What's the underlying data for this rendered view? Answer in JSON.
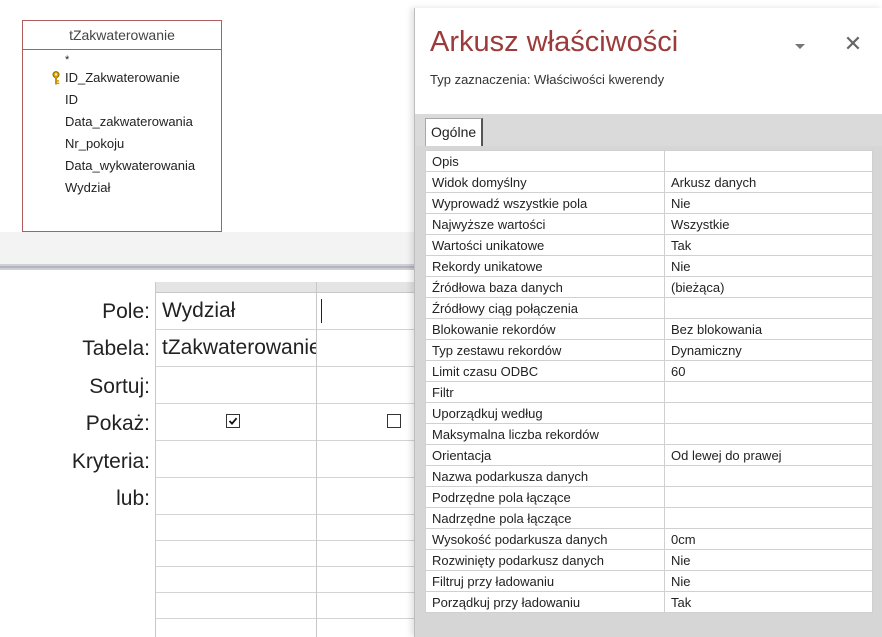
{
  "table": {
    "title": "tZakwaterowanie",
    "fields": [
      {
        "name": "*",
        "key": false
      },
      {
        "name": "ID_Zakwaterowanie",
        "key": true
      },
      {
        "name": "ID",
        "key": false
      },
      {
        "name": "Data_zakwaterowania",
        "key": false
      },
      {
        "name": "Nr_pokoju",
        "key": false
      },
      {
        "name": "Data_wykwaterowania",
        "key": false
      },
      {
        "name": "Wydział",
        "key": false
      }
    ]
  },
  "grid": {
    "row_labels": {
      "field": "Pole:",
      "table": "Tabela:",
      "sort": "Sortuj:",
      "show": "Pokaż:",
      "criteria": "Kryteria:",
      "or": "lub:"
    },
    "columns": [
      {
        "field": "Wydział",
        "table": "tZakwaterowanie",
        "sort": "",
        "show": true,
        "criteria": "",
        "or": ""
      },
      {
        "field": "",
        "table": "",
        "sort": "",
        "show": false,
        "criteria": "",
        "or": ""
      }
    ]
  },
  "property_sheet": {
    "title": "Arkusz właściwości",
    "selection_type": "Typ zaznaczenia:  Właściwości kwerendy",
    "close_glyph": "✕",
    "tab": "Ogólne",
    "properties": [
      {
        "name": "Opis",
        "value": ""
      },
      {
        "name": "Widok domyślny",
        "value": "Arkusz danych"
      },
      {
        "name": "Wyprowadź wszystkie pola",
        "value": "Nie"
      },
      {
        "name": "Najwyższe wartości",
        "value": "Wszystkie"
      },
      {
        "name": "Wartości unikatowe",
        "value": "Tak"
      },
      {
        "name": "Rekordy unikatowe",
        "value": "Nie"
      },
      {
        "name": "Źródłowa baza danych",
        "value": "(bieżąca)"
      },
      {
        "name": "Źródłowy ciąg połączenia",
        "value": ""
      },
      {
        "name": "Blokowanie rekordów",
        "value": "Bez blokowania"
      },
      {
        "name": "Typ zestawu rekordów",
        "value": "Dynamiczny"
      },
      {
        "name": "Limit czasu ODBC",
        "value": "60"
      },
      {
        "name": "Filtr",
        "value": ""
      },
      {
        "name": "Uporządkuj według",
        "value": ""
      },
      {
        "name": "Maksymalna liczba rekordów",
        "value": ""
      },
      {
        "name": "Orientacja",
        "value": "Od lewej do prawej"
      },
      {
        "name": "Nazwa podarkusza danych",
        "value": ""
      },
      {
        "name": "Podrzędne pola łączące",
        "value": ""
      },
      {
        "name": "Nadrzędne pola łączące",
        "value": ""
      },
      {
        "name": "Wysokość podarkusza danych",
        "value": "0cm"
      },
      {
        "name": "Rozwinięty podarkusz danych",
        "value": "Nie"
      },
      {
        "name": "Filtruj przy ładowaniu",
        "value": "Nie"
      },
      {
        "name": "Porządkuj przy ładowaniu",
        "value": "Tak"
      }
    ]
  },
  "colors": {
    "title_red": "#9b3b3b",
    "table_border": "#b05d5d"
  },
  "icons": {
    "primary_key": "key-icon",
    "dropdown": "chevron-down-icon",
    "close": "close-icon",
    "checkbox_checked": "checkbox-checked-icon",
    "checkbox_unchecked": "checkbox-unchecked-icon"
  }
}
